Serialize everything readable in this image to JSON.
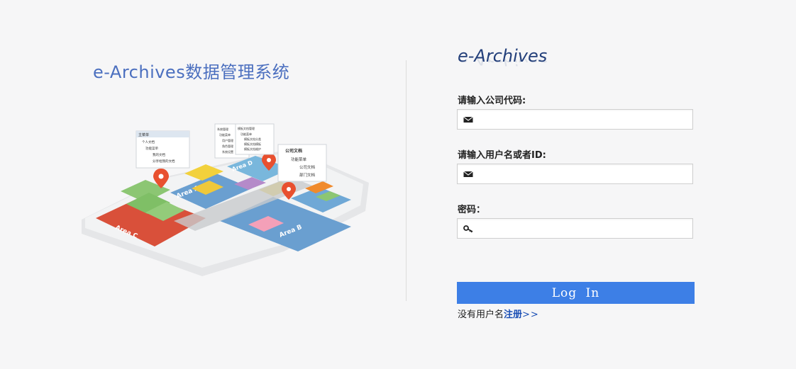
{
  "app_title": "e-Archives数据管理系统",
  "illustration": {
    "panels": [
      {
        "title": "主菜单",
        "items": [
          "个人文档",
          "功能菜单",
          "我的文档",
          "分享给我的文档"
        ]
      },
      {
        "title": "系统管理",
        "items": [
          "功能菜单",
          "用户管理",
          "角色管理",
          "系统设置"
        ]
      },
      {
        "title": "模板文档管理",
        "items": [
          "功能菜单",
          "模板文档分类",
          "模板文档模板",
          "模板文档维护"
        ]
      },
      {
        "title": "公司文档",
        "items": [
          "功能菜单",
          "公司文档",
          "部门文档"
        ]
      }
    ],
    "areas": [
      "Area A",
      "Area B",
      "Area C",
      "Area D"
    ]
  },
  "logo": {
    "text": "e-Archives"
  },
  "form": {
    "company_code": {
      "label": "请输入公司代码:",
      "value": "",
      "icon": "envelope-icon"
    },
    "username": {
      "label": "请输入用户名或者ID:",
      "value": "",
      "icon": "envelope-icon"
    },
    "password": {
      "label": "密码：",
      "value": "",
      "icon": "key-icon"
    },
    "login_button": "Log  In"
  },
  "register": {
    "prefix": "没有用户名",
    "link": "注册",
    "arrows": ">>"
  },
  "colors": {
    "button": "#3d7fe6",
    "title": "#4b6fbf",
    "logo": "#233f7a",
    "area_red": "#d9503a",
    "area_blue": "#6a9fd0"
  }
}
